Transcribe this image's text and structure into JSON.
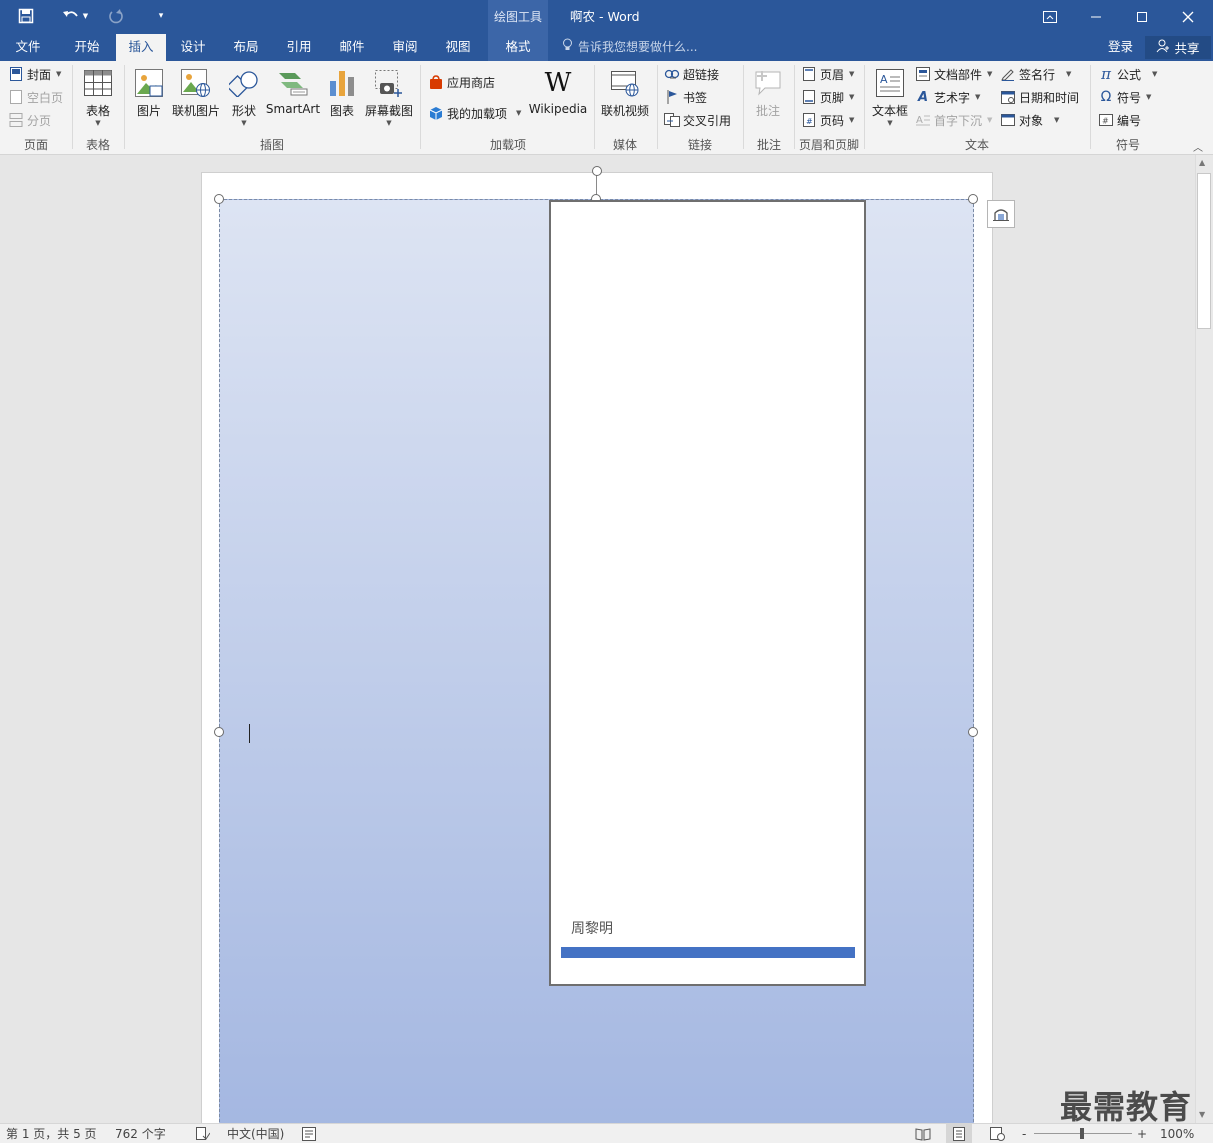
{
  "titlebar": {
    "context_group": "绘图工具",
    "doc_title": "啊农 - Word",
    "qat": {
      "save_icon": "save-icon",
      "undo_icon": "undo-icon",
      "redo_icon": "redo-icon",
      "customize_icon": "customize-qat-icon"
    },
    "window_controls": {
      "ribbon_display": "ribbon-display-icon",
      "minimize": "minimize-icon",
      "maximize": "maximize-icon",
      "close": "close-icon"
    }
  },
  "tabs": [
    {
      "label": "文件"
    },
    {
      "label": "开始"
    },
    {
      "label": "插入"
    },
    {
      "label": "设计"
    },
    {
      "label": "布局"
    },
    {
      "label": "引用"
    },
    {
      "label": "邮件"
    },
    {
      "label": "审阅"
    },
    {
      "label": "视图"
    },
    {
      "label": "格式"
    }
  ],
  "active_tab": "插入",
  "tell_me": "告诉我您想要做什么...",
  "login": "登录",
  "share": "共享",
  "ribbon": {
    "pages": {
      "cover": "封面",
      "blank": "空白页",
      "break": "分页",
      "label": "页面"
    },
    "tables": {
      "table": "表格",
      "label": "表格"
    },
    "illustrations": {
      "picture": "图片",
      "online_picture": "联机图片",
      "shapes": "形状",
      "smartart": "SmartArt",
      "chart": "图表",
      "screenshot": "屏幕截图",
      "label": "插图"
    },
    "addins": {
      "store": "应用商店",
      "my_addins": "我的加载项",
      "wikipedia": "Wikipedia",
      "label": "加载项"
    },
    "media": {
      "online_video": "联机视频",
      "label": "媒体"
    },
    "links": {
      "hyperlink": "超链接",
      "bookmark": "书签",
      "cross_ref": "交叉引用",
      "label": "链接"
    },
    "comments": {
      "comment": "批注",
      "label": "批注"
    },
    "header_footer": {
      "header": "页眉",
      "footer": "页脚",
      "page_number": "页码",
      "label": "页眉和页脚"
    },
    "text": {
      "textbox": "文本框",
      "quick_parts": "文档部件",
      "wordart": "艺术字",
      "dropcap": "首字下沉",
      "signature": "签名行",
      "datetime": "日期和时间",
      "object": "对象",
      "label": "文本"
    },
    "symbols": {
      "equation": "公式",
      "symbol": "符号",
      "number": "编号",
      "label": "符号"
    }
  },
  "document": {
    "author": "周黎明",
    "accent_color": "#4472c4"
  },
  "statusbar": {
    "page": "第 1 页，共 5 页",
    "words": "762 个字",
    "language": "中文(中国)",
    "zoom": "100%",
    "zoom_minus": "-",
    "zoom_plus": "+"
  },
  "watermark": "最需教育",
  "colors": {
    "brand": "#2b579a",
    "ribbon_bg": "#f3f3f3"
  }
}
